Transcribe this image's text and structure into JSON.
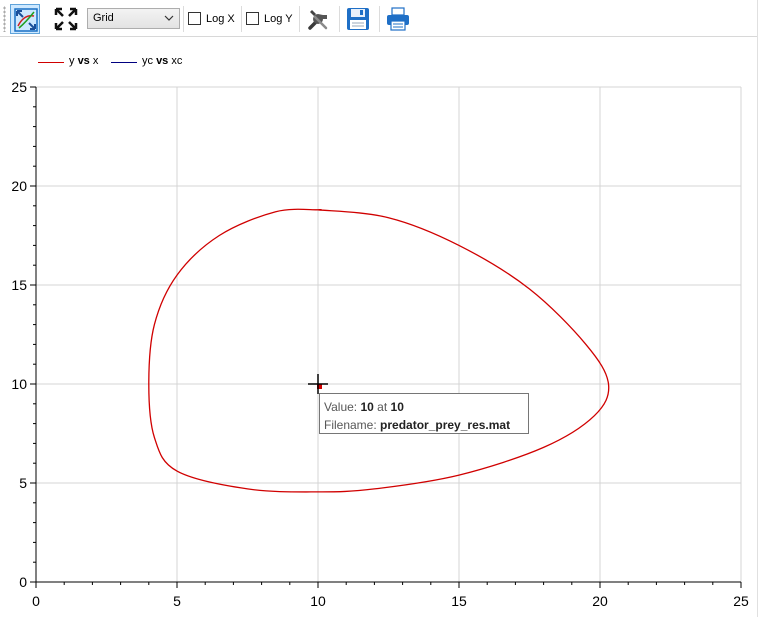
{
  "toolbar": {
    "fit_icon": "fit-in-view-icon",
    "fullscreen_icon": "fullscreen-icon",
    "grid_select": {
      "value": "Grid"
    },
    "log_x": {
      "label": "Log X",
      "checked": false
    },
    "log_y": {
      "label": "Log Y",
      "checked": false
    },
    "setup_icon": "setup-tools-icon",
    "save_icon": "save-icon",
    "print_icon": "print-icon"
  },
  "tooltip": {
    "value_prefix": "Value: ",
    "value": "10",
    "at": " at ",
    "at_value": "10",
    "filename_prefix": "Filename: ",
    "filename": "predator_prey_res.mat"
  },
  "chart_data": {
    "type": "line",
    "grid": true,
    "legend_position": "top-left",
    "xlim": [
      0,
      25
    ],
    "ylim": [
      0,
      25
    ],
    "x_ticks": [
      "0",
      "5",
      "10",
      "15",
      "20",
      "25"
    ],
    "y_ticks": [
      "0",
      "5",
      "10",
      "15",
      "20",
      "25"
    ],
    "series": [
      {
        "name_parts": [
          "y",
          "vs",
          "x"
        ],
        "color": "#d00000",
        "x": [
          10,
          12.5,
          15,
          17.5,
          19.5,
          20.3,
          19.8,
          18,
          15,
          12,
          10,
          7.5,
          5,
          4.2,
          4,
          4.2,
          5,
          6.5,
          8.5,
          10,
          10
        ],
        "y": [
          18.8,
          18.4,
          17.0,
          14.8,
          12.0,
          10.0,
          8.4,
          6.8,
          5.4,
          4.7,
          4.55,
          4.7,
          5.6,
          7.3,
          10.0,
          13.0,
          15.5,
          17.5,
          18.7,
          18.8,
          18.8
        ]
      },
      {
        "name_parts": [
          "yc",
          "vs",
          "xc"
        ],
        "color": "#000080",
        "x": [],
        "y": []
      }
    ],
    "cursor": {
      "x": 10,
      "y": 10
    }
  }
}
